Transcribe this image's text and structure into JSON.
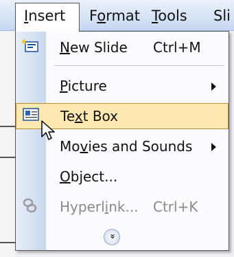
{
  "menubar": {
    "insert": {
      "pre": "",
      "u": "I",
      "post": "nsert"
    },
    "format": {
      "pre": "F",
      "u": "o",
      "post": "rmat"
    },
    "tools": {
      "pre": "",
      "u": "T",
      "post": "ools"
    },
    "slide_show": {
      "pre": "Sli",
      "u": "",
      "post": ""
    }
  },
  "menu": {
    "items": [
      {
        "pre": "",
        "u": "N",
        "post": "ew Slide",
        "shortcut": "Ctrl+M",
        "icon": "new-slide-icon"
      },
      {
        "pre": "",
        "u": "P",
        "post": "icture",
        "submenu": true
      },
      {
        "pre": "Te",
        "u": "x",
        "post": "t Box",
        "icon": "text-box-icon",
        "highlighted": true
      },
      {
        "pre": "Mo",
        "u": "v",
        "post": "ies and Sounds",
        "submenu": true
      },
      {
        "pre": "",
        "u": "O",
        "post": "bject..."
      },
      {
        "pre": "Hyperl",
        "u": "i",
        "post": "nk...",
        "shortcut": "Ctrl+K",
        "icon": "hyperlink-icon",
        "disabled": true
      }
    ],
    "expand_glyph": "»",
    "expand_icon": "expand-chevron-icon"
  },
  "colors": {
    "highlight_bg": "#ffe9b0",
    "highlight_border": "#c28f2c",
    "menubar_top": "#eaf1fb",
    "menubar_bottom": "#c6d7f1"
  }
}
